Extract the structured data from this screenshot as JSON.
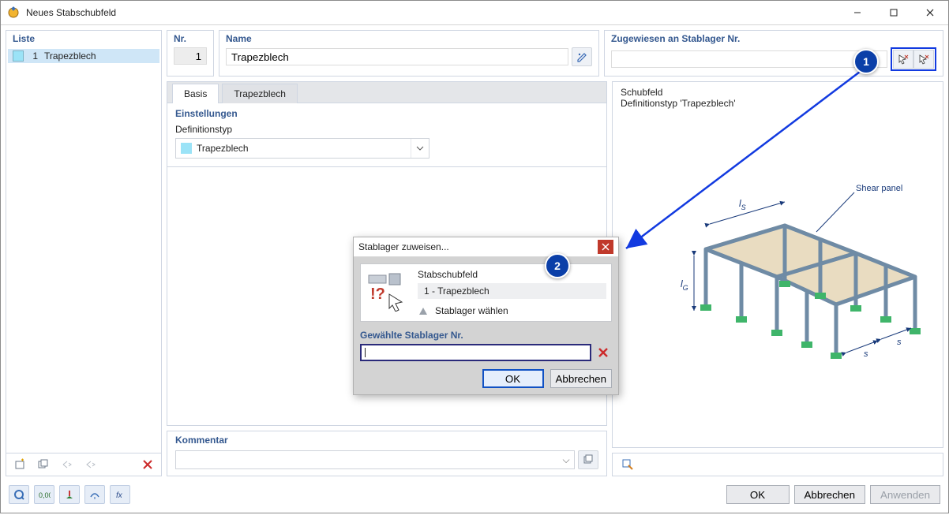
{
  "window": {
    "title": "Neues Stabschubfeld"
  },
  "list": {
    "heading": "Liste",
    "item_no": "1",
    "item_label": "Trapezblech"
  },
  "nr": {
    "heading": "Nr.",
    "value": "1"
  },
  "name": {
    "heading": "Name",
    "value": "Trapezblech"
  },
  "assign": {
    "heading": "Zugewiesen an Stablager Nr.",
    "value": ""
  },
  "tabs": {
    "basis": "Basis",
    "trapez": "Trapezblech"
  },
  "settings": {
    "heading": "Einstellungen",
    "def_label": "Definitionstyp",
    "def_value": "Trapezblech"
  },
  "comment": {
    "heading": "Kommentar"
  },
  "preview": {
    "title": "Schubfeld",
    "subtitle": "Definitionstyp 'Trapezblech'",
    "shear_label": "Shear panel",
    "ls": "l",
    "ls_sub": "S",
    "lg": "l",
    "lg_sub": "G",
    "s": "s"
  },
  "dialog": {
    "title": "Stablager zuweisen...",
    "schubfeld": "Stabschubfeld",
    "item": "1 - Trapezblech",
    "choose": "Stablager wählen",
    "selected_label": "Gewählte Stablager Nr.",
    "ok": "OK",
    "cancel": "Abbrechen"
  },
  "buttons": {
    "ok": "OK",
    "cancel": "Abbrechen",
    "apply": "Anwenden"
  },
  "callouts": {
    "one": "1",
    "two": "2"
  }
}
